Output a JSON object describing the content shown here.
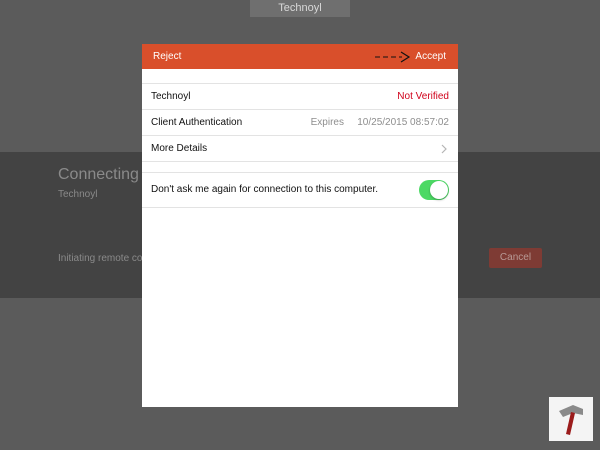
{
  "background": {
    "top_label": "Technoyl",
    "connecting_title": "Connecting to",
    "connecting_host": "Technoyl",
    "status_text": "Initiating remote co",
    "cancel_label": "Cancel"
  },
  "dialog": {
    "reject_label": "Reject",
    "accept_label": "Accept",
    "rows": [
      {
        "label": "Technoyl",
        "value": "Not Verified"
      },
      {
        "label": "Client Authentication",
        "expires_label": "Expires",
        "value": "10/25/2015 08:57:02"
      },
      {
        "label": "More Details"
      }
    ],
    "toggle": {
      "label": "Don't ask me again for connection to this computer.",
      "on": true
    }
  },
  "colors": {
    "header": "#d94f2b",
    "not_verified": "#d0021b",
    "toggle_on": "#4cd964"
  },
  "icons": {
    "annotation": "dashed-arrow-icon",
    "disclosure": "chevron-right-icon",
    "watermark": "hammer-logo-icon"
  }
}
